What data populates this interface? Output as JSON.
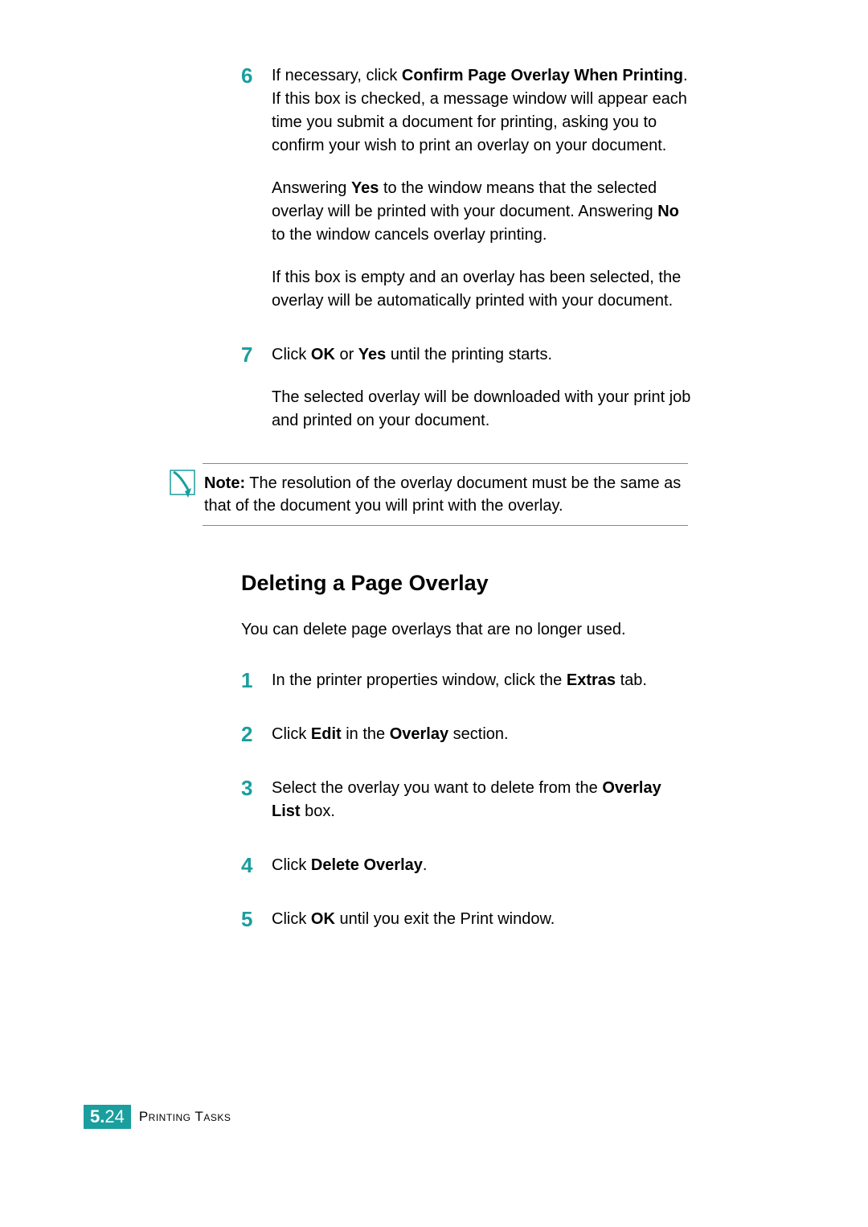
{
  "steps_top": [
    {
      "num": "6",
      "paras": [
        [
          {
            "t": "If necessary, click "
          },
          {
            "t": "Confirm Page Overlay When Printing",
            "b": true
          },
          {
            "t": ". If this box is checked, a message window will appear each time you submit a document for printing, asking you to confirm your wish to print an overlay on your document."
          }
        ],
        [
          {
            "t": "Answering "
          },
          {
            "t": "Yes",
            "b": true
          },
          {
            "t": " to the window means that the selected overlay will be printed with your document. Answering "
          },
          {
            "t": "No",
            "b": true
          },
          {
            "t": " to the window cancels overlay printing."
          }
        ],
        [
          {
            "t": "If this box is empty and an overlay has been selected, the overlay will be automatically printed with your document."
          }
        ]
      ]
    },
    {
      "num": "7",
      "paras": [
        [
          {
            "t": "Click "
          },
          {
            "t": "OK",
            "b": true
          },
          {
            "t": " or "
          },
          {
            "t": "Yes",
            "b": true
          },
          {
            "t": " until the printing starts."
          }
        ],
        [
          {
            "t": "The selected overlay will be downloaded with your print job and printed on your document."
          }
        ]
      ]
    }
  ],
  "note": {
    "label": "Note:",
    "text": " The resolution of the overlay document must be the same as that of the document you will print with the overlay."
  },
  "section": {
    "heading": "Deleting a Page Overlay",
    "intro": "You can delete page overlays that are no longer used.",
    "steps": [
      {
        "num": "1",
        "paras": [
          [
            {
              "t": "In the printer properties window, click the "
            },
            {
              "t": "Extras",
              "b": true
            },
            {
              "t": " tab."
            }
          ]
        ]
      },
      {
        "num": "2",
        "paras": [
          [
            {
              "t": "Click "
            },
            {
              "t": "Edit",
              "b": true
            },
            {
              "t": " in the "
            },
            {
              "t": "Overlay",
              "b": true
            },
            {
              "t": " section."
            }
          ]
        ]
      },
      {
        "num": "3",
        "paras": [
          [
            {
              "t": "Select the overlay you want to delete from the "
            },
            {
              "t": "Overlay List",
              "b": true
            },
            {
              "t": " box."
            }
          ]
        ]
      },
      {
        "num": "4",
        "paras": [
          [
            {
              "t": "Click "
            },
            {
              "t": "Delete Overlay",
              "b": true
            },
            {
              "t": "."
            }
          ]
        ]
      },
      {
        "num": "5",
        "paras": [
          [
            {
              "t": "Click "
            },
            {
              "t": "OK",
              "b": true
            },
            {
              "t": " until you exit the Print window."
            }
          ]
        ]
      }
    ]
  },
  "footer": {
    "chapter": "5.",
    "page": "24",
    "title": "Printing Tasks"
  },
  "colors": {
    "accent": "#1a9e9e"
  }
}
